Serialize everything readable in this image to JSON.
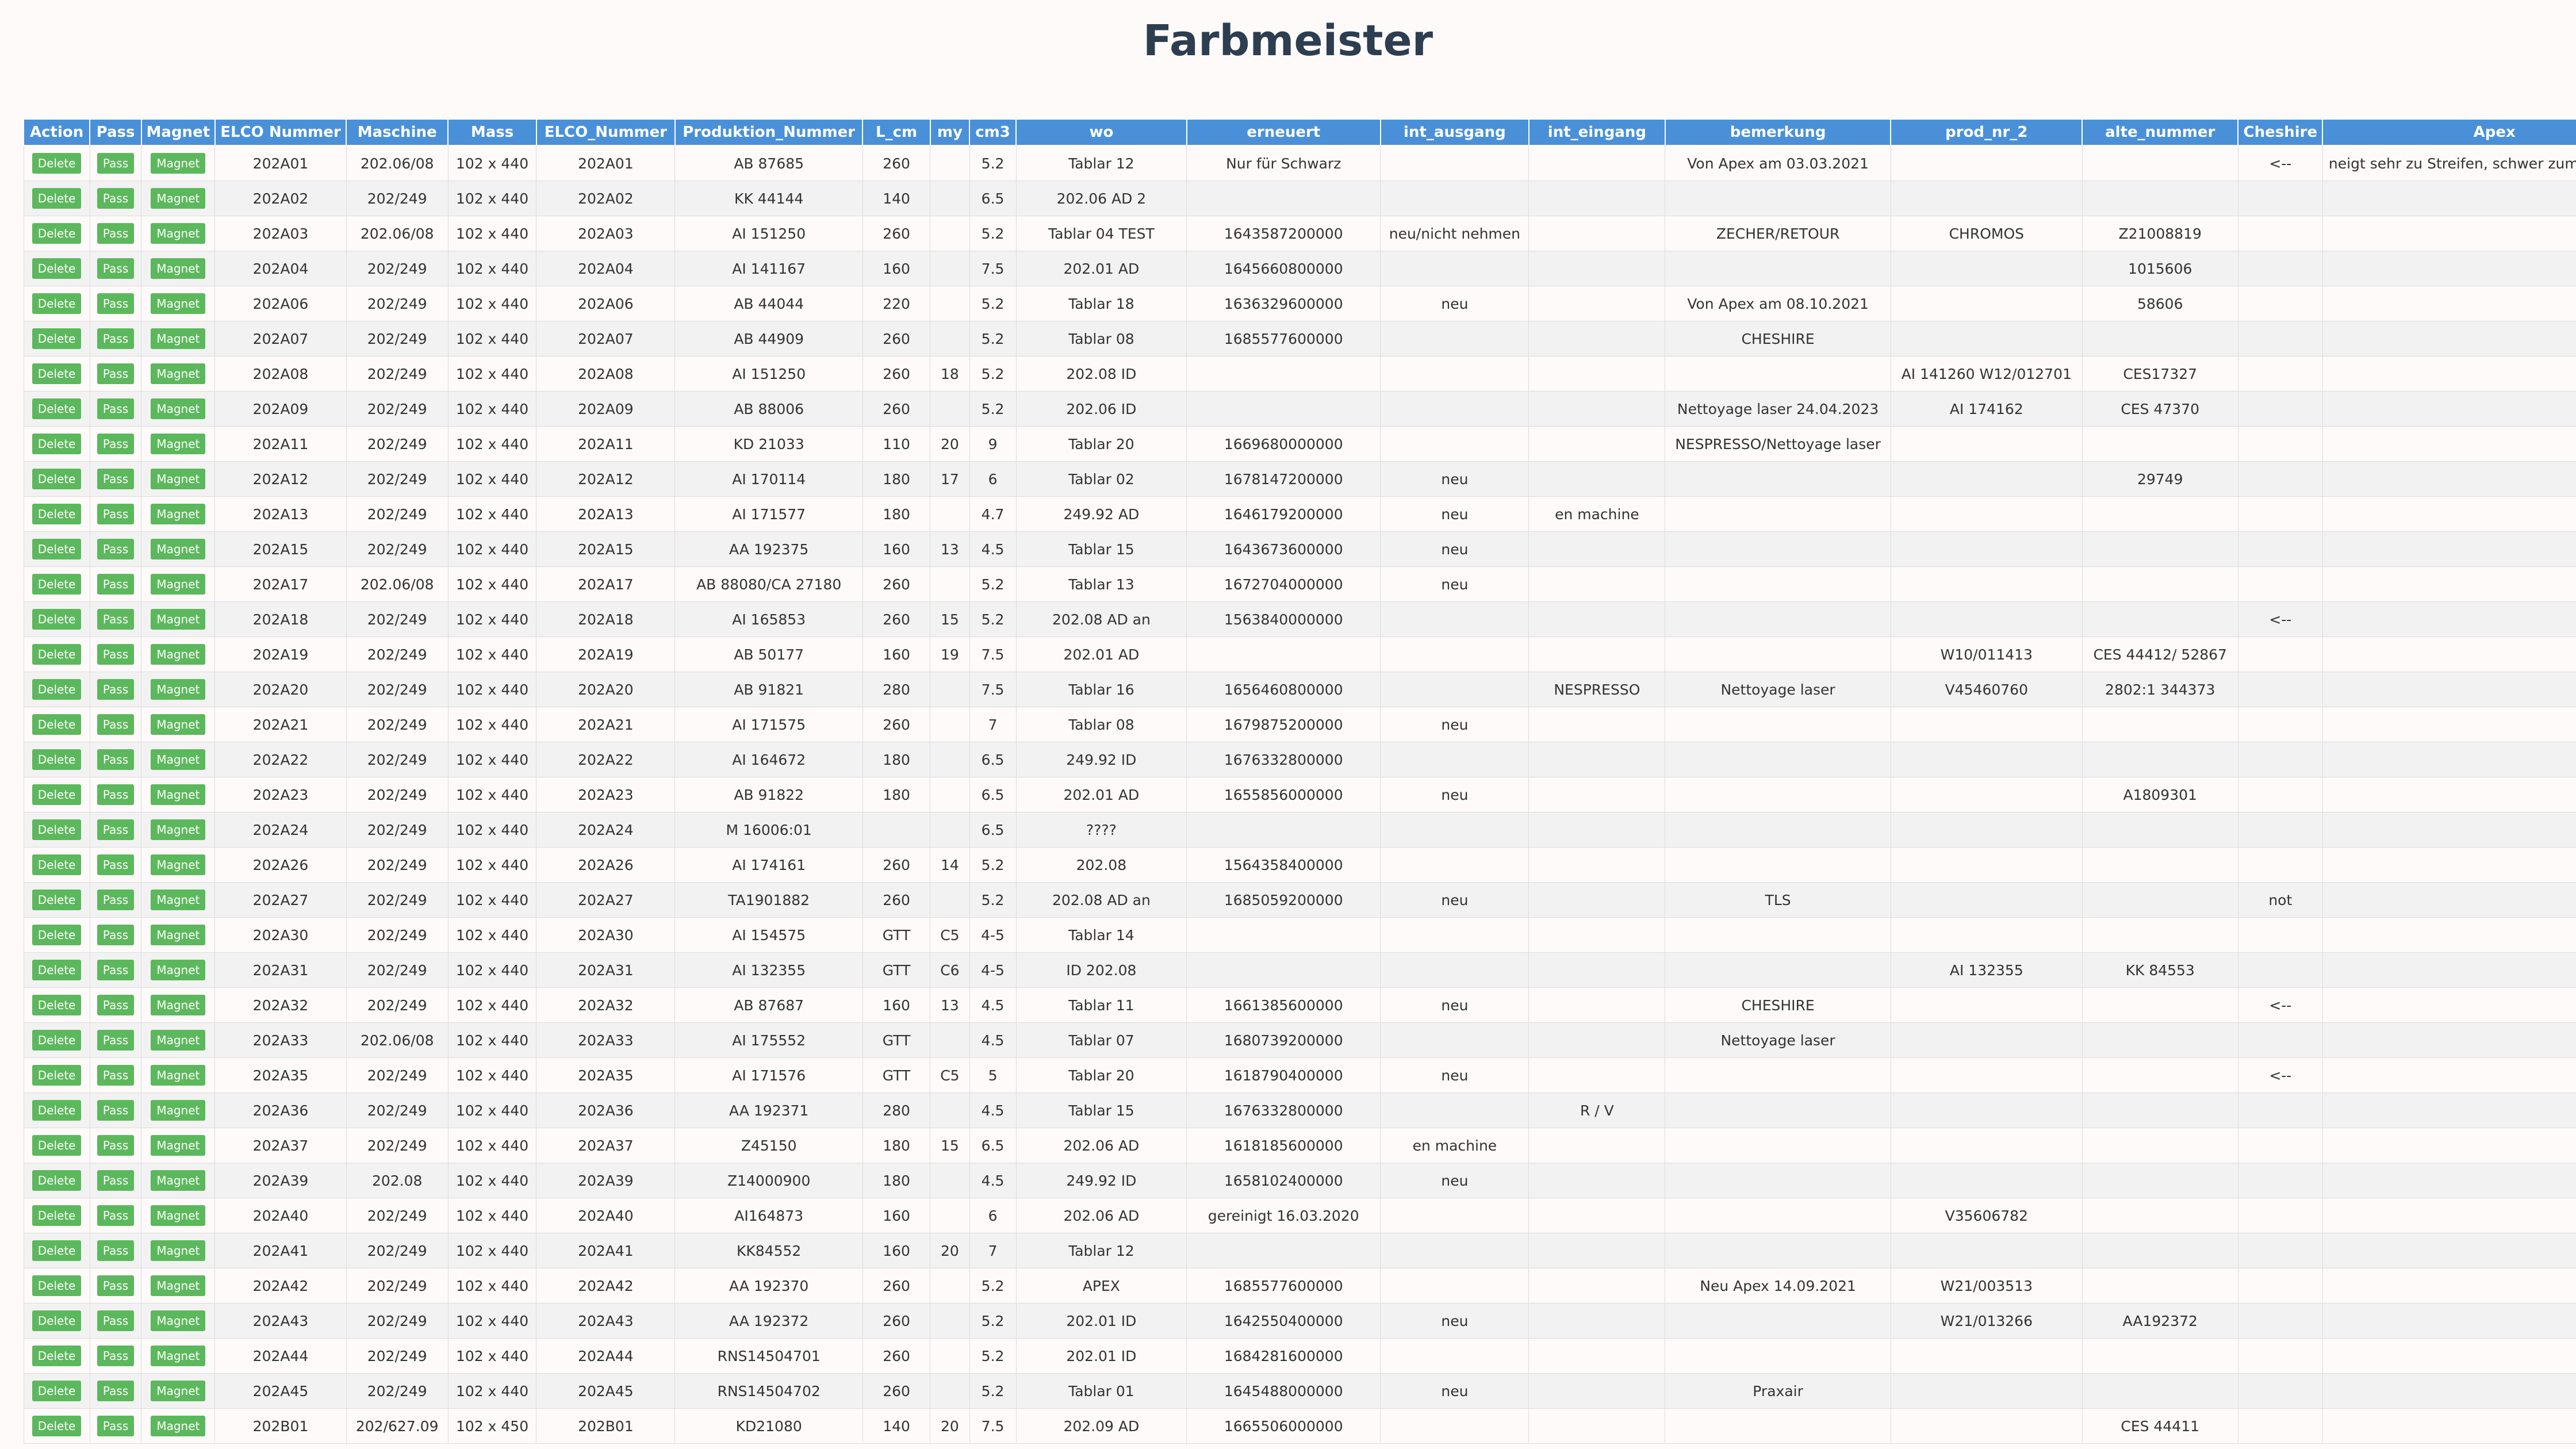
{
  "title": "Farbmeister",
  "buttons": {
    "delete": "Delete",
    "pass": "Pass",
    "magnet": "Magnet"
  },
  "columns": [
    "Action",
    "Pass",
    "Magnet",
    "ELCO Nummer",
    "Maschine",
    "Mass",
    "ELCO_Nummer",
    "Produktion_Nummer",
    "L_cm",
    "my",
    "cm3",
    "wo",
    "erneuert",
    "int_ausgang",
    "int_eingang",
    "bemerkung",
    "prod_nr_2",
    "alte_nummer",
    "Cheshire",
    "Apex"
  ],
  "rows": [
    [
      "202A01",
      "202.06/08",
      "102 x 440",
      "202A01",
      "AB 87685",
      "260",
      "",
      "5.2",
      "Tablar 12",
      "Nur für Schwarz",
      "",
      "",
      "Von Apex am 03.03.2021",
      "",
      "",
      "<--",
      "neigt sehr zu Streifen, schwer zum Putzen, mit Steinet u"
    ],
    [
      "202A02",
      "202/249",
      "102 x 440",
      "202A02",
      "KK 44144",
      "140",
      "",
      "6.5",
      "202.06 AD 2",
      "",
      "",
      "",
      "",
      "",
      "",
      "",
      ""
    ],
    [
      "202A03",
      "202.06/08",
      "102 x 440",
      "202A03",
      "AI 151250",
      "260",
      "",
      "5.2",
      "Tablar 04 TEST",
      "1643587200000",
      "neu/nicht nehmen",
      "",
      "ZECHER/RETOUR",
      "CHROMOS",
      "Z21008819",
      "",
      ""
    ],
    [
      "202A04",
      "202/249",
      "102 x 440",
      "202A04",
      "AI 141167",
      "160",
      "",
      "7.5",
      "202.01 AD",
      "1645660800000",
      "",
      "",
      "",
      "",
      "1015606",
      "",
      ""
    ],
    [
      "202A06",
      "202/249",
      "102 x 440",
      "202A06",
      "AB 44044",
      "220",
      "",
      "5.2",
      "Tablar 18",
      "1636329600000",
      "neu",
      "",
      "Von Apex am 08.10.2021",
      "",
      "58606",
      "",
      ""
    ],
    [
      "202A07",
      "202/249",
      "102 x 440",
      "202A07",
      "AB 44909",
      "260",
      "",
      "5.2",
      "Tablar 08",
      "1685577600000",
      "",
      "",
      "CHESHIRE",
      "",
      "",
      "",
      ""
    ],
    [
      "202A08",
      "202/249",
      "102 x 440",
      "202A08",
      "AI 151250",
      "260",
      "18",
      "5.2",
      "202.08 ID",
      "",
      "",
      "",
      "",
      "AI 141260 W12/012701",
      "CES17327",
      "",
      ""
    ],
    [
      "202A09",
      "202/249",
      "102 x 440",
      "202A09",
      "AB 88006",
      "260",
      "",
      "5.2",
      "202.06 ID",
      "",
      "",
      "",
      "Nettoyage laser 24.04.2023",
      "AI 174162",
      "CES 47370",
      "",
      ""
    ],
    [
      "202A11",
      "202/249",
      "102 x 440",
      "202A11",
      "KD 21033",
      "110",
      "20",
      "9",
      "Tablar 20",
      "1669680000000",
      "",
      "",
      "NESPRESSO/Nettoyage laser",
      "",
      "",
      "",
      ""
    ],
    [
      "202A12",
      "202/249",
      "102 x 440",
      "202A12",
      "AI 170114",
      "180",
      "17",
      "6",
      "Tablar 02",
      "1678147200000",
      "neu",
      "",
      "",
      "",
      "29749",
      "",
      ""
    ],
    [
      "202A13",
      "202/249",
      "102 x 440",
      "202A13",
      "AI 171577",
      "180",
      "",
      "4.7",
      "249.92 AD",
      "1646179200000",
      "neu",
      "en machine",
      "",
      "",
      "",
      "",
      ""
    ],
    [
      "202A15",
      "202/249",
      "102 x 440",
      "202A15",
      "AA 192375",
      "160",
      "13",
      "4.5",
      "Tablar 15",
      "1643673600000",
      "neu",
      "",
      "",
      "",
      "",
      "",
      ""
    ],
    [
      "202A17",
      "202.06/08",
      "102 x 440",
      "202A17",
      "AB 88080/CA 27180",
      "260",
      "",
      "5.2",
      "Tablar 13",
      "1672704000000",
      "neu",
      "",
      "",
      "",
      "",
      "",
      ""
    ],
    [
      "202A18",
      "202/249",
      "102 x 440",
      "202A18",
      "AI 165853",
      "260",
      "15",
      "5.2",
      "202.08 AD an",
      "1563840000000",
      "",
      "",
      "",
      "",
      "",
      "<--",
      ""
    ],
    [
      "202A19",
      "202/249",
      "102 x 440",
      "202A19",
      "AB 50177",
      "160",
      "19",
      "7.5",
      "202.01 AD",
      "",
      "",
      "",
      "",
      "W10/011413",
      "CES 44412/ 52867",
      "",
      ""
    ],
    [
      "202A20",
      "202/249",
      "102 x 440",
      "202A20",
      "AB 91821",
      "280",
      "",
      "7.5",
      "Tablar 16",
      "1656460800000",
      "",
      "NESPRESSO",
      "Nettoyage laser",
      "V45460760",
      "2802:1 344373",
      "",
      ""
    ],
    [
      "202A21",
      "202/249",
      "102 x 440",
      "202A21",
      "AI 171575",
      "260",
      "",
      "7",
      "Tablar 08",
      "1679875200000",
      "neu",
      "",
      "",
      "",
      "",
      "",
      ""
    ],
    [
      "202A22",
      "202/249",
      "102 x 440",
      "202A22",
      "AI 164672",
      "180",
      "",
      "6.5",
      "249.92 ID",
      "1676332800000",
      "",
      "",
      "",
      "",
      "",
      "",
      ""
    ],
    [
      "202A23",
      "202/249",
      "102 x 440",
      "202A23",
      "AB 91822",
      "180",
      "",
      "6.5",
      "202.01 AD",
      "1655856000000",
      "neu",
      "",
      "",
      "",
      "A1809301",
      "",
      ""
    ],
    [
      "202A24",
      "202/249",
      "102 x 440",
      "202A24",
      "M 16006:01",
      "",
      "",
      "6.5",
      "????",
      "",
      "",
      "",
      "",
      "",
      "",
      "",
      ""
    ],
    [
      "202A26",
      "202/249",
      "102 x 440",
      "202A26",
      "AI 174161",
      "260",
      "14",
      "5.2",
      "202.08",
      "1564358400000",
      "",
      "",
      "",
      "",
      "",
      "",
      ""
    ],
    [
      "202A27",
      "202/249",
      "102 x 440",
      "202A27",
      "TA1901882",
      "260",
      "",
      "5.2",
      "202.08 AD an",
      "1685059200000",
      "neu",
      "",
      "TLS",
      "",
      "",
      "not",
      ""
    ],
    [
      "202A30",
      "202/249",
      "102 x 440",
      "202A30",
      "AI 154575",
      "GTT",
      "C5",
      "4-5",
      "Tablar 14",
      "",
      "",
      "",
      "",
      "",
      "",
      "",
      ""
    ],
    [
      "202A31",
      "202/249",
      "102 x 440",
      "202A31",
      "AI 132355",
      "GTT",
      "C6",
      "4-5",
      "ID 202.08",
      "",
      "",
      "",
      "",
      "AI 132355",
      "KK 84553",
      "",
      ""
    ],
    [
      "202A32",
      "202/249",
      "102 x 440",
      "202A32",
      "AB 87687",
      "160",
      "13",
      "4.5",
      "Tablar 11",
      "1661385600000",
      "neu",
      "",
      "CHESHIRE",
      "",
      "",
      "<--",
      ""
    ],
    [
      "202A33",
      "202.06/08",
      "102 x 440",
      "202A33",
      "AI 175552",
      "GTT",
      "",
      "4.5",
      "Tablar 07",
      "1680739200000",
      "",
      "",
      "Nettoyage laser",
      "",
      "",
      "",
      ""
    ],
    [
      "202A35",
      "202/249",
      "102 x 440",
      "202A35",
      "AI 171576",
      "GTT",
      "C5",
      "5",
      "Tablar 20",
      "1618790400000",
      "neu",
      "",
      "",
      "",
      "",
      "<--",
      ""
    ],
    [
      "202A36",
      "202/249",
      "102 x 440",
      "202A36",
      "AA 192371",
      "280",
      "",
      "4.5",
      "Tablar 15",
      "1676332800000",
      "",
      "R / V",
      "",
      "",
      "",
      "",
      ""
    ],
    [
      "202A37",
      "202/249",
      "102 x 440",
      "202A37",
      "Z45150",
      "180",
      "15",
      "6.5",
      "202.06 AD",
      "1618185600000",
      "en machine",
      "",
      "",
      "",
      "",
      "",
      ""
    ],
    [
      "202A39",
      "202.08",
      "102 x 440",
      "202A39",
      "Z14000900",
      "180",
      "",
      "4.5",
      "249.92 ID",
      "1658102400000",
      "neu",
      "",
      "",
      "",
      "",
      "",
      ""
    ],
    [
      "202A40",
      "202/249",
      "102 x 440",
      "202A40",
      "AI164873",
      "160",
      "",
      "6",
      "202.06 AD",
      "gereinigt 16.03.2020",
      "",
      "",
      "",
      "V35606782",
      "",
      "",
      ""
    ],
    [
      "202A41",
      "202/249",
      "102 x 440",
      "202A41",
      "KK84552",
      "160",
      "20",
      "7",
      "Tablar 12",
      "",
      "",
      "",
      "",
      "",
      "",
      "",
      ""
    ],
    [
      "202A42",
      "202/249",
      "102 x 440",
      "202A42",
      "AA 192370",
      "260",
      "",
      "5.2",
      "APEX",
      "1685577600000",
      "",
      "",
      "Neu Apex 14.09.2021",
      "W21/003513",
      "",
      "",
      ""
    ],
    [
      "202A43",
      "202/249",
      "102 x 440",
      "202A43",
      "AA 192372",
      "260",
      "",
      "5.2",
      "202.01 ID",
      "1642550400000",
      "neu",
      "",
      "",
      "W21/013266",
      "AA192372",
      "",
      ""
    ],
    [
      "202A44",
      "202/249",
      "102 x 440",
      "202A44",
      "RNS14504701",
      "260",
      "",
      "5.2",
      "202.01 ID",
      "1684281600000",
      "",
      "",
      "",
      "",
      "",
      "",
      ""
    ],
    [
      "202A45",
      "202/249",
      "102 x 440",
      "202A45",
      "RNS14504702",
      "260",
      "",
      "5.2",
      "Tablar 01",
      "1645488000000",
      "neu",
      "",
      "Praxair",
      "",
      "",
      "",
      ""
    ],
    [
      "202B01",
      "202/627.09",
      "102 x 450",
      "202B01",
      "KD21080",
      "140",
      "20",
      "7.5",
      "202.09 AD",
      "1665506000000",
      "",
      "",
      "",
      "",
      "CES 44411",
      "",
      ""
    ]
  ]
}
